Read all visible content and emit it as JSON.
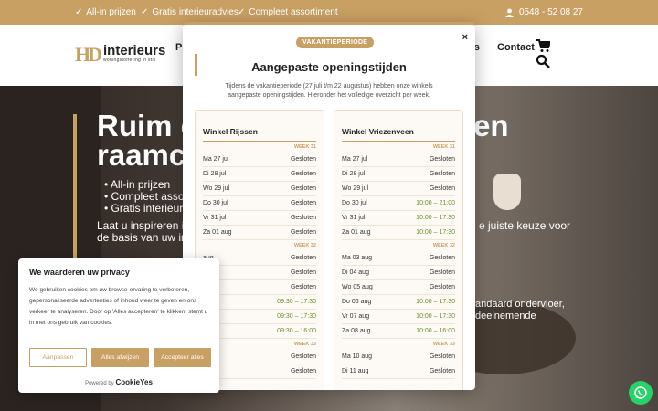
{
  "topbar": {
    "usps": [
      "All-in prijzen",
      "Gratis interieuradvies",
      "Compleet assortiment"
    ],
    "phone": "0548 - 52 08 27"
  },
  "header": {
    "logo_mark": "HD",
    "logo_name": "interieurs",
    "logo_sub": "woningstoffering in stijl",
    "nav_fragment_left": "P",
    "nav_fragment_right": "gs",
    "nav_contact": "Contact"
  },
  "hero": {
    "title_left": [
      "Ruim c",
      "raamc"
    ],
    "title_right": [
      "en",
      ""
    ],
    "bullets": [
      "All-in prijzen",
      "Compleet asso",
      "Gratis interieur"
    ],
    "sub_left": [
      "Laat u inspireren in",
      "de basis van uw int"
    ],
    "sub_right": [
      "e juiste keuze voor",
      ""
    ],
    "frag2": [
      "andaard ondervloer,",
      "deelnemende"
    ]
  },
  "modal": {
    "badge": "VAKANTIEPERIODE",
    "close": "×",
    "title": "Aangepaste openingstijden",
    "intro": "Tijdens de vakantieperiode (27 juli t/m 22 augustus) hebben onze winkels aangepaste openingstijden. Hieronder het volledige overzicht per week.",
    "stores": [
      {
        "name": "Winkel Rijssen",
        "weeks": [
          {
            "label": "WEEK 31",
            "rows": [
              {
                "day": "Ma 27 jul",
                "time": "Gesloten",
                "open": false
              },
              {
                "day": "Di 28 jul",
                "time": "Gesloten",
                "open": false
              },
              {
                "day": "Wo 29 jul",
                "time": "Gesloten",
                "open": false
              },
              {
                "day": "Do 30 jul",
                "time": "Gesloten",
                "open": false
              },
              {
                "day": "Vr 31 jul",
                "time": "Gesloten",
                "open": false
              },
              {
                "day": "Za 01 aug",
                "time": "Gesloten",
                "open": false
              }
            ]
          },
          {
            "label": "WEEK 32",
            "rows": [
              {
                "day": "aug",
                "time": "Gesloten",
                "open": false
              },
              {
                "day": "aug",
                "time": "Gesloten",
                "open": false
              },
              {
                "day": "aug",
                "time": "Gesloten",
                "open": false
              },
              {
                "day": "aug",
                "time": "09:30 – 17:30",
                "open": true
              },
              {
                "day": "aug",
                "time": "09:30 – 17:30",
                "open": true
              },
              {
                "day": "aug",
                "time": "09:30 – 16:00",
                "open": true
              }
            ]
          },
          {
            "label": "WEEK 33",
            "rows": [
              {
                "day": "aug",
                "time": "Gesloten",
                "open": false
              },
              {
                "day": "aug",
                "time": "Gesloten",
                "open": false
              }
            ]
          }
        ]
      },
      {
        "name": "Winkel Vriezenveen",
        "weeks": [
          {
            "label": "WEEK 31",
            "rows": [
              {
                "day": "Ma 27 jul",
                "time": "Gesloten",
                "open": false
              },
              {
                "day": "Di 28 jul",
                "time": "Gesloten",
                "open": false
              },
              {
                "day": "Wo 29 jul",
                "time": "Gesloten",
                "open": false
              },
              {
                "day": "Do 30 jul",
                "time": "10:00 – 21:00",
                "open": true
              },
              {
                "day": "Vr 31 jul",
                "time": "10:00 – 17:30",
                "open": true
              },
              {
                "day": "Za 01 aug",
                "time": "10:00 – 17:30",
                "open": true
              }
            ]
          },
          {
            "label": "WEEK 32",
            "rows": [
              {
                "day": "Ma 03 aug",
                "time": "Gesloten",
                "open": false
              },
              {
                "day": "Di 04 aug",
                "time": "Gesloten",
                "open": false
              },
              {
                "day": "Wo 05 aug",
                "time": "Gesloten",
                "open": false
              },
              {
                "day": "Do 06 aug",
                "time": "10:00 – 17:30",
                "open": true
              },
              {
                "day": "Vr 07 aug",
                "time": "10:00 – 17:30",
                "open": true
              },
              {
                "day": "Za 08 aug",
                "time": "10:00 – 16:00",
                "open": true
              }
            ]
          },
          {
            "label": "WEEK 33",
            "rows": [
              {
                "day": "Ma 10 aug",
                "time": "Gesloten",
                "open": false
              },
              {
                "day": "Di 11 aug",
                "time": "Gesloten",
                "open": false
              }
            ]
          }
        ]
      }
    ]
  },
  "cookie": {
    "title": "We waarderen uw privacy",
    "text": "We gebruiken cookies om uw browse-ervaring te verbeteren, gepersonaliseerde advertenties of inhoud weer te geven en ons verkeer te analyseren. Door op 'Alles accepteren' te klikken, stemt u in met ons gebruik van cookies.",
    "btn_customize": "Aanpassen",
    "btn_reject": "Alles afwijzen",
    "btn_accept": "Accepteer alles",
    "powered_prefix": "Powered by",
    "powered_brand": "CookieYes"
  },
  "colors": {
    "accent": "#c9a063",
    "open_time": "#6b8f2a",
    "whatsapp": "#25d366"
  },
  "icons": [
    "check-icon",
    "user-icon",
    "cart-icon",
    "search-icon",
    "close-icon",
    "whatsapp-icon"
  ]
}
